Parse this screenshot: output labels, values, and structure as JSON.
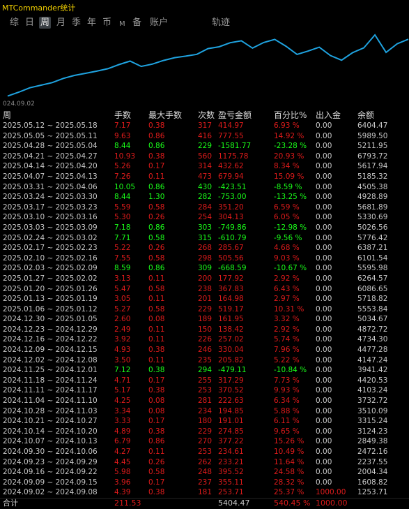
{
  "title": "MTCommander统计",
  "tabs": [
    {
      "label": "综",
      "active": false
    },
    {
      "label": "日",
      "active": false
    },
    {
      "label": "周",
      "active": true
    },
    {
      "label": "月",
      "active": false
    },
    {
      "label": "季",
      "active": false
    },
    {
      "label": "年",
      "active": false
    },
    {
      "label": "币",
      "active": false
    },
    {
      "label": "M",
      "active": false
    },
    {
      "label": "备",
      "active": false
    },
    {
      "label": "账户",
      "active": false
    },
    {
      "label": "轨迹",
      "active": false
    }
  ],
  "chart": {
    "start_label": "024.09.02",
    "line_color": "#1fa3e0",
    "balance_series": [
      1253.71,
      1608.82,
      2004.34,
      2237.55,
      2472.16,
      2849.38,
      3124.23,
      3315.24,
      3510.09,
      3732.72,
      4103.24,
      4420.53,
      3941.42,
      4147.24,
      4477.28,
      4734.3,
      4872.72,
      5034.67,
      5553.84,
      5718.82,
      6086.65,
      6264.57,
      5595.98,
      6101.54,
      6387.21,
      5776.42,
      5026.56,
      5330.69,
      5681.89,
      4928.89,
      4505.38,
      5185.32,
      5617.94,
      6793.72,
      5211.95,
      5989.5,
      6404.47
    ]
  },
  "table": {
    "headers": [
      "周",
      "手数",
      "最大手数",
      "次数",
      "盈亏金额",
      "百分比%",
      "出入金",
      "余额"
    ],
    "rows": [
      {
        "week": "2025.05.12 ~ 2025.05.18",
        "lots": "7.17",
        "max_lots": "0.38",
        "count": "317",
        "pnl": "414.97",
        "pct": "6.93 %",
        "flow": "0.00",
        "balance": "6404.47",
        "sign": "pos"
      },
      {
        "week": "2025.05.05 ~ 2025.05.11",
        "lots": "9.63",
        "max_lots": "0.86",
        "count": "416",
        "pnl": "777.55",
        "pct": "14.92 %",
        "flow": "0.00",
        "balance": "5989.50",
        "sign": "pos"
      },
      {
        "week": "2025.04.28 ~ 2025.05.04",
        "lots": "8.44",
        "max_lots": "0.86",
        "count": "229",
        "pnl": "-1581.77",
        "pct": "-23.28 %",
        "flow": "0.00",
        "balance": "5211.95",
        "sign": "neg"
      },
      {
        "week": "2025.04.21 ~ 2025.04.27",
        "lots": "10.93",
        "max_lots": "0.38",
        "count": "560",
        "pnl": "1175.78",
        "pct": "20.93 %",
        "flow": "0.00",
        "balance": "6793.72",
        "sign": "pos"
      },
      {
        "week": "2025.04.14 ~ 2025.04.20",
        "lots": "5.26",
        "max_lots": "0.17",
        "count": "314",
        "pnl": "432.62",
        "pct": "8.34 %",
        "flow": "0.00",
        "balance": "5617.94",
        "sign": "pos"
      },
      {
        "week": "2025.04.07 ~ 2025.04.13",
        "lots": "7.26",
        "max_lots": "0.11",
        "count": "473",
        "pnl": "679.94",
        "pct": "15.09 %",
        "flow": "0.00",
        "balance": "5185.32",
        "sign": "pos"
      },
      {
        "week": "2025.03.31 ~ 2025.04.06",
        "lots": "10.05",
        "max_lots": "0.86",
        "count": "430",
        "pnl": "-423.51",
        "pct": "-8.59 %",
        "flow": "0.00",
        "balance": "4505.38",
        "sign": "neg"
      },
      {
        "week": "2025.03.24 ~ 2025.03.30",
        "lots": "8.44",
        "max_lots": "1.30",
        "count": "282",
        "pnl": "-753.00",
        "pct": "-13.25 %",
        "flow": "0.00",
        "balance": "4928.89",
        "sign": "neg"
      },
      {
        "week": "2025.03.17 ~ 2025.03.23",
        "lots": "5.59",
        "max_lots": "0.58",
        "count": "284",
        "pnl": "351.20",
        "pct": "6.59 %",
        "flow": "0.00",
        "balance": "5681.89",
        "sign": "pos"
      },
      {
        "week": "2025.03.10 ~ 2025.03.16",
        "lots": "5.30",
        "max_lots": "0.26",
        "count": "254",
        "pnl": "304.13",
        "pct": "6.05 %",
        "flow": "0.00",
        "balance": "5330.69",
        "sign": "pos"
      },
      {
        "week": "2025.03.03 ~ 2025.03.09",
        "lots": "7.18",
        "max_lots": "0.86",
        "count": "303",
        "pnl": "-749.86",
        "pct": "-12.98 %",
        "flow": "0.00",
        "balance": "5026.56",
        "sign": "neg"
      },
      {
        "week": "2025.02.24 ~ 2025.03.02",
        "lots": "7.71",
        "max_lots": "0.58",
        "count": "315",
        "pnl": "-610.79",
        "pct": "-9.56 %",
        "flow": "0.00",
        "balance": "5776.42",
        "sign": "neg"
      },
      {
        "week": "2025.02.17 ~ 2025.02.23",
        "lots": "5.22",
        "max_lots": "0.26",
        "count": "268",
        "pnl": "285.67",
        "pct": "4.68 %",
        "flow": "0.00",
        "balance": "6387.21",
        "sign": "pos"
      },
      {
        "week": "2025.02.10 ~ 2025.02.16",
        "lots": "7.55",
        "max_lots": "0.58",
        "count": "298",
        "pnl": "505.56",
        "pct": "9.03 %",
        "flow": "0.00",
        "balance": "6101.54",
        "sign": "pos"
      },
      {
        "week": "2025.02.03 ~ 2025.02.09",
        "lots": "8.59",
        "max_lots": "0.86",
        "count": "309",
        "pnl": "-668.59",
        "pct": "-10.67 %",
        "flow": "0.00",
        "balance": "5595.98",
        "sign": "neg"
      },
      {
        "week": "2025.01.27 ~ 2025.02.02",
        "lots": "3.13",
        "max_lots": "0.11",
        "count": "200",
        "pnl": "177.92",
        "pct": "2.92 %",
        "flow": "0.00",
        "balance": "6264.57",
        "sign": "pos"
      },
      {
        "week": "2025.01.20 ~ 2025.01.26",
        "lots": "5.47",
        "max_lots": "0.58",
        "count": "238",
        "pnl": "367.83",
        "pct": "6.43 %",
        "flow": "0.00",
        "balance": "6086.65",
        "sign": "pos"
      },
      {
        "week": "2025.01.13 ~ 2025.01.19",
        "lots": "3.05",
        "max_lots": "0.11",
        "count": "201",
        "pnl": "164.98",
        "pct": "2.97 %",
        "flow": "0.00",
        "balance": "5718.82",
        "sign": "pos"
      },
      {
        "week": "2025.01.06 ~ 2025.01.12",
        "lots": "5.27",
        "max_lots": "0.58",
        "count": "229",
        "pnl": "519.17",
        "pct": "10.31 %",
        "flow": "0.00",
        "balance": "5553.84",
        "sign": "pos"
      },
      {
        "week": "2024.12.30 ~ 2025.01.05",
        "lots": "2.60",
        "max_lots": "0.08",
        "count": "189",
        "pnl": "161.95",
        "pct": "3.32 %",
        "flow": "0.00",
        "balance": "5034.67",
        "sign": "pos"
      },
      {
        "week": "2024.12.23 ~ 2024.12.29",
        "lots": "2.49",
        "max_lots": "0.11",
        "count": "150",
        "pnl": "138.42",
        "pct": "2.92 %",
        "flow": "0.00",
        "balance": "4872.72",
        "sign": "pos"
      },
      {
        "week": "2024.12.16 ~ 2024.12.22",
        "lots": "3.92",
        "max_lots": "0.11",
        "count": "226",
        "pnl": "257.02",
        "pct": "5.74 %",
        "flow": "0.00",
        "balance": "4734.30",
        "sign": "pos"
      },
      {
        "week": "2024.12.09 ~ 2024.12.15",
        "lots": "4.93",
        "max_lots": "0.38",
        "count": "246",
        "pnl": "330.04",
        "pct": "7.96 %",
        "flow": "0.00",
        "balance": "4477.28",
        "sign": "pos"
      },
      {
        "week": "2024.12.02 ~ 2024.12.08",
        "lots": "3.50",
        "max_lots": "0.11",
        "count": "235",
        "pnl": "205.82",
        "pct": "5.22 %",
        "flow": "0.00",
        "balance": "4147.24",
        "sign": "pos"
      },
      {
        "week": "2024.11.25 ~ 2024.12.01",
        "lots": "7.12",
        "max_lots": "0.38",
        "count": "294",
        "pnl": "-479.11",
        "pct": "-10.84 %",
        "flow": "0.00",
        "balance": "3941.42",
        "sign": "neg"
      },
      {
        "week": "2024.11.18 ~ 2024.11.24",
        "lots": "4.71",
        "max_lots": "0.17",
        "count": "255",
        "pnl": "317.29",
        "pct": "7.73 %",
        "flow": "0.00",
        "balance": "4420.53",
        "sign": "pos"
      },
      {
        "week": "2024.11.11 ~ 2024.11.17",
        "lots": "5.17",
        "max_lots": "0.38",
        "count": "253",
        "pnl": "370.52",
        "pct": "9.93 %",
        "flow": "0.00",
        "balance": "4103.24",
        "sign": "pos"
      },
      {
        "week": "2024.11.04 ~ 2024.11.10",
        "lots": "4.25",
        "max_lots": "0.08",
        "count": "281",
        "pnl": "222.63",
        "pct": "6.34 %",
        "flow": "0.00",
        "balance": "3732.72",
        "sign": "pos"
      },
      {
        "week": "2024.10.28 ~ 2024.11.03",
        "lots": "3.34",
        "max_lots": "0.08",
        "count": "234",
        "pnl": "194.85",
        "pct": "5.88 %",
        "flow": "0.00",
        "balance": "3510.09",
        "sign": "pos"
      },
      {
        "week": "2024.10.21 ~ 2024.10.27",
        "lots": "3.33",
        "max_lots": "0.17",
        "count": "180",
        "pnl": "191.01",
        "pct": "6.11 %",
        "flow": "0.00",
        "balance": "3315.24",
        "sign": "pos"
      },
      {
        "week": "2024.10.14 ~ 2024.10.20",
        "lots": "4.89",
        "max_lots": "0.38",
        "count": "229",
        "pnl": "274.85",
        "pct": "9.65 %",
        "flow": "0.00",
        "balance": "3124.23",
        "sign": "pos"
      },
      {
        "week": "2024.10.07 ~ 2024.10.13",
        "lots": "6.79",
        "max_lots": "0.86",
        "count": "270",
        "pnl": "377.22",
        "pct": "15.26 %",
        "flow": "0.00",
        "balance": "2849.38",
        "sign": "pos"
      },
      {
        "week": "2024.09.30 ~ 2024.10.06",
        "lots": "4.27",
        "max_lots": "0.11",
        "count": "253",
        "pnl": "234.61",
        "pct": "10.49 %",
        "flow": "0.00",
        "balance": "2472.16",
        "sign": "pos"
      },
      {
        "week": "2024.09.23 ~ 2024.09.29",
        "lots": "4.45",
        "max_lots": "0.26",
        "count": "262",
        "pnl": "233.21",
        "pct": "11.64 %",
        "flow": "0.00",
        "balance": "2237.55",
        "sign": "pos"
      },
      {
        "week": "2024.09.16 ~ 2024.09.22",
        "lots": "5.98",
        "max_lots": "0.58",
        "count": "248",
        "pnl": "395.52",
        "pct": "24.58 %",
        "flow": "0.00",
        "balance": "2004.34",
        "sign": "pos"
      },
      {
        "week": "2024.09.09 ~ 2024.09.15",
        "lots": "3.96",
        "max_lots": "0.17",
        "count": "237",
        "pnl": "355.11",
        "pct": "28.32 %",
        "flow": "0.00",
        "balance": "1608.82",
        "sign": "pos"
      },
      {
        "week": "2024.09.02 ~ 2024.09.08",
        "lots": "4.39",
        "max_lots": "0.38",
        "count": "181",
        "pnl": "253.71",
        "pct": "25.37 %",
        "flow": "1000.00",
        "balance": "1253.71",
        "sign": "pos"
      }
    ],
    "total": {
      "label": "合计",
      "lots": "211.53",
      "pnl": "5404.47",
      "pct": "540.45 %",
      "flow": "1000.00"
    }
  },
  "colors": {
    "title": "#f2d000",
    "positive": "#e01b1b",
    "negative": "#19ff19",
    "chart_line": "#1fa3e0"
  }
}
